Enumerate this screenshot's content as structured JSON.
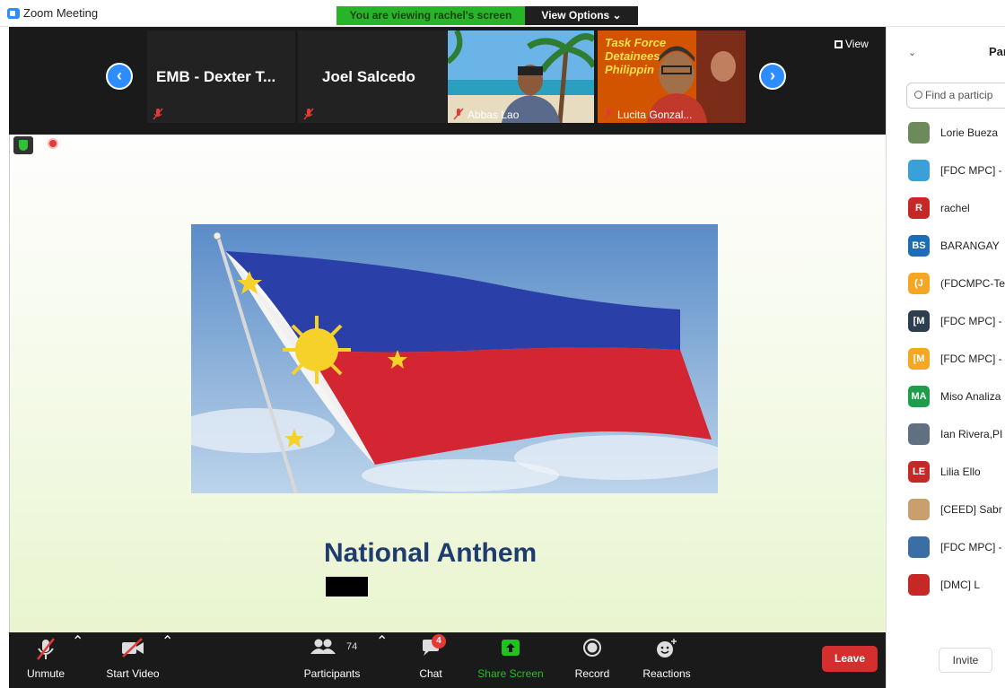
{
  "window": {
    "title": "Zoom Meeting"
  },
  "banner": {
    "viewing": "You are viewing rachel's screen",
    "view_options": "View Options ⌄"
  },
  "strip": {
    "view_label": "View",
    "tiles": [
      {
        "name": "EMB - Dexter T..."
      },
      {
        "name": "Joel Salcedo"
      },
      {
        "name": "Abbas Lao"
      },
      {
        "name": "Lucita Gonzal..."
      }
    ],
    "poster_text": [
      "Task Force",
      "Detainees",
      "Philippin"
    ]
  },
  "slide": {
    "title": "National Anthem"
  },
  "toolbar": {
    "unmute": "Unmute",
    "start_video": "Start Video",
    "participants": "Participants",
    "participants_count": "74",
    "chat": "Chat",
    "chat_badge": "4",
    "share_screen": "Share Screen",
    "record": "Record",
    "reactions": "Reactions",
    "leave": "Leave"
  },
  "panel": {
    "title": "Par",
    "search_placeholder": "Find a particip",
    "invite": "Invite",
    "participants": [
      {
        "name": "Lorie Bueza",
        "initials": "",
        "color": "#6d8a5a"
      },
      {
        "name": "[FDC MPC] -",
        "initials": "",
        "color": "#3aa0d8"
      },
      {
        "name": "rachel",
        "initials": "R",
        "color": "#c62828"
      },
      {
        "name": "BARANGAY",
        "initials": "BS",
        "color": "#1e6bb8"
      },
      {
        "name": "(FDCMPC-Te",
        "initials": "(J",
        "color": "#f5a623"
      },
      {
        "name": "[FDC MPC] -",
        "initials": "[M",
        "color": "#2c3e50"
      },
      {
        "name": "[FDC MPC] -",
        "initials": "[M",
        "color": "#f5a623"
      },
      {
        "name": "Miso Analiza",
        "initials": "MA",
        "color": "#1e9e4a"
      },
      {
        "name": "Ian Rivera,PI",
        "initials": "",
        "color": "#607080"
      },
      {
        "name": "Lilia Ello",
        "initials": "LE",
        "color": "#c62828"
      },
      {
        "name": "[CEED] Sabr",
        "initials": "",
        "color": "#c8a070"
      },
      {
        "name": "[FDC MPC] -",
        "initials": "",
        "color": "#3a6ea5"
      },
      {
        "name": "[DMC] L",
        "initials": "",
        "color": "#c62828"
      }
    ]
  },
  "colors": {
    "accent": "#2d8cff",
    "leave": "#d32f2f",
    "share_green": "#1ec31e",
    "anthem_blue": "#1f3c6e"
  }
}
